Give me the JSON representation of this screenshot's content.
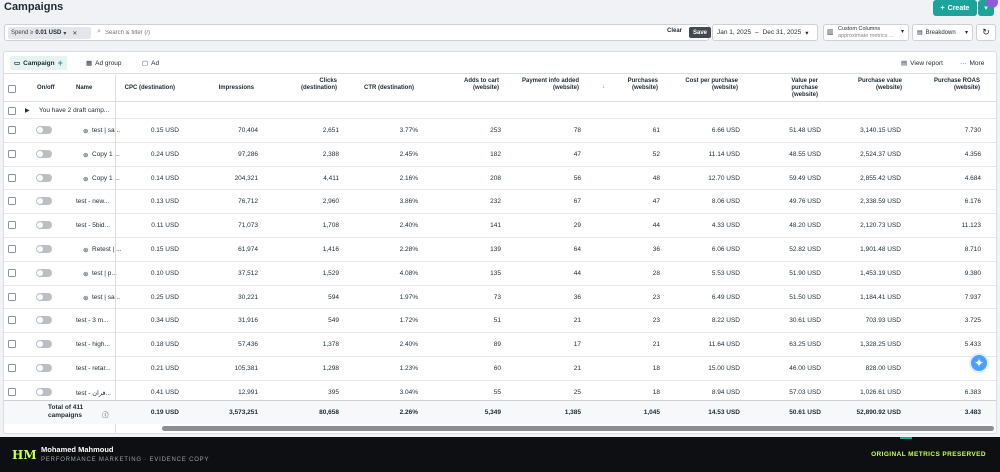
{
  "header": {
    "title": "Campaigns",
    "create_label": "Create"
  },
  "filter": {
    "chip_prefix": "Spend ≥",
    "chip_value": "0.01 USD",
    "search_placeholder": "Search & filter (/)",
    "clear_label": "Clear",
    "save_label": "Save"
  },
  "date_range": {
    "start": "Jan 1, 2025",
    "separator": "–",
    "end": "Dec 31, 2025"
  },
  "columns_control": {
    "label": "Custom Columns",
    "sub": "approximate metrics ..."
  },
  "breakdown_label": "Breakdown",
  "tabs": [
    {
      "label": "Campaign",
      "active": true
    },
    {
      "label": "Ad group",
      "active": false
    },
    {
      "label": "Ad",
      "active": false
    }
  ],
  "toolbar": {
    "view_report": "View report",
    "more": "More"
  },
  "table": {
    "columns": [
      "On/off",
      "Name",
      "CPC (destination)",
      "Impressions",
      "Clicks (destination)",
      "CTR (destination)",
      "Adds to cart (website)",
      "Payment info added (website)",
      "Purchases (website)",
      "Cost per purchase (website)",
      "Value per purchase (website)",
      "Purchase value (website)",
      "Purchase ROAS (website)"
    ],
    "draft_row": "You have 2 draft camp...",
    "rows": [
      {
        "icon": true,
        "name": "test | sa...",
        "cpc": "0.15 USD",
        "impr": "70,404",
        "clicks": "2,651",
        "ctr": "3.77%",
        "atc": "253",
        "pay": "78",
        "purch": "61",
        "cpp": "6.66 USD",
        "vpp": "51.48 USD",
        "pv": "3,140.15 USD",
        "roas": "7.730"
      },
      {
        "icon": true,
        "name": "Copy 1 ...",
        "cpc": "0.24 USD",
        "impr": "97,286",
        "clicks": "2,388",
        "ctr": "2.45%",
        "atc": "182",
        "pay": "47",
        "purch": "52",
        "cpp": "11.14 USD",
        "vpp": "48.55 USD",
        "pv": "2,524.37 USD",
        "roas": "4.356"
      },
      {
        "icon": true,
        "name": "Copy 1 ...",
        "cpc": "0.14 USD",
        "impr": "204,321",
        "clicks": "4,411",
        "ctr": "2.16%",
        "atc": "208",
        "pay": "56",
        "purch": "48",
        "cpp": "12.70 USD",
        "vpp": "59.49 USD",
        "pv": "2,855.42 USD",
        "roas": "4.684"
      },
      {
        "icon": false,
        "name": "test - new...",
        "cpc": "0.13 USD",
        "impr": "76,712",
        "clicks": "2,960",
        "ctr": "3.86%",
        "atc": "232",
        "pay": "67",
        "purch": "47",
        "cpp": "8.06 USD",
        "vpp": "49.76 USD",
        "pv": "2,338.59 USD",
        "roas": "6.176"
      },
      {
        "icon": false,
        "name": "test - 5bid...",
        "cpc": "0.11 USD",
        "impr": "71,073",
        "clicks": "1,708",
        "ctr": "2.40%",
        "atc": "141",
        "pay": "29",
        "purch": "44",
        "cpp": "4.33 USD",
        "vpp": "48.20 USD",
        "pv": "2,120.73 USD",
        "roas": "11.123"
      },
      {
        "icon": true,
        "name": "Retest | ...",
        "cpc": "0.15 USD",
        "impr": "61,974",
        "clicks": "1,416",
        "ctr": "2.28%",
        "atc": "139",
        "pay": "64",
        "purch": "36",
        "cpp": "6.06 USD",
        "vpp": "52.82 USD",
        "pv": "1,901.48 USD",
        "roas": "8.710"
      },
      {
        "icon": true,
        "name": "test | p...",
        "cpc": "0.10 USD",
        "impr": "37,512",
        "clicks": "1,529",
        "ctr": "4.08%",
        "atc": "135",
        "pay": "44",
        "purch": "28",
        "cpp": "5.53 USD",
        "vpp": "51.90 USD",
        "pv": "1,453.19 USD",
        "roas": "9.380"
      },
      {
        "icon": true,
        "name": "test | sa...",
        "cpc": "0.25 USD",
        "impr": "30,221",
        "clicks": "594",
        "ctr": "1.97%",
        "atc": "73",
        "pay": "36",
        "purch": "23",
        "cpp": "6.49 USD",
        "vpp": "51.50 USD",
        "pv": "1,184.41 USD",
        "roas": "7.937"
      },
      {
        "icon": false,
        "name": "test - 3 m...",
        "cpc": "0.34 USD",
        "impr": "31,916",
        "clicks": "549",
        "ctr": "1.72%",
        "atc": "51",
        "pay": "21",
        "purch": "23",
        "cpp": "8.22 USD",
        "vpp": "30.61 USD",
        "pv": "703.93 USD",
        "roas": "3.725"
      },
      {
        "icon": false,
        "name": "test - high...",
        "cpc": "0.18 USD",
        "impr": "57,436",
        "clicks": "1,378",
        "ctr": "2.40%",
        "atc": "89",
        "pay": "17",
        "purch": "21",
        "cpp": "11.64 USD",
        "vpp": "63.25 USD",
        "pv": "1,328.25 USD",
        "roas": "5.433"
      },
      {
        "icon": false,
        "name": "test - retar...",
        "cpc": "0.21 USD",
        "impr": "105,381",
        "clicks": "1,298",
        "ctr": "1.23%",
        "atc": "60",
        "pay": "21",
        "purch": "18",
        "cpp": "15.00 USD",
        "vpp": "46.00 USD",
        "pv": "828.00 USD",
        "roas": ""
      },
      {
        "icon": false,
        "name": "test - فران...",
        "cpc": "0.41 USD",
        "impr": "12,991",
        "clicks": "395",
        "ctr": "3.04%",
        "atc": "55",
        "pay": "25",
        "purch": "18",
        "cpp": "8.94 USD",
        "vpp": "57.03 USD",
        "pv": "1,026.61 USD",
        "roas": "6.383"
      }
    ],
    "total": {
      "label": "Total of 411 campaigns",
      "cpc": "0.19 USD",
      "impr": "3,573,251",
      "clicks": "80,658",
      "ctr": "2.26%",
      "atc": "5,349",
      "pay": "1,385",
      "purch": "1,045",
      "cpp": "14.53 USD",
      "vpp": "50.61 USD",
      "pv": "52,890.92 USD",
      "roas": "3.483"
    }
  },
  "footer": {
    "logo": "HM",
    "name": "Mohamed Mahmoud",
    "subtitle": "PERFORMANCE MARKETING · EVIDENCE COPY",
    "badge": "ORIGINAL METRICS PRESERVED"
  },
  "colors": {
    "accent": "#1ba39c",
    "footer_accent": "#c8ff4d"
  }
}
